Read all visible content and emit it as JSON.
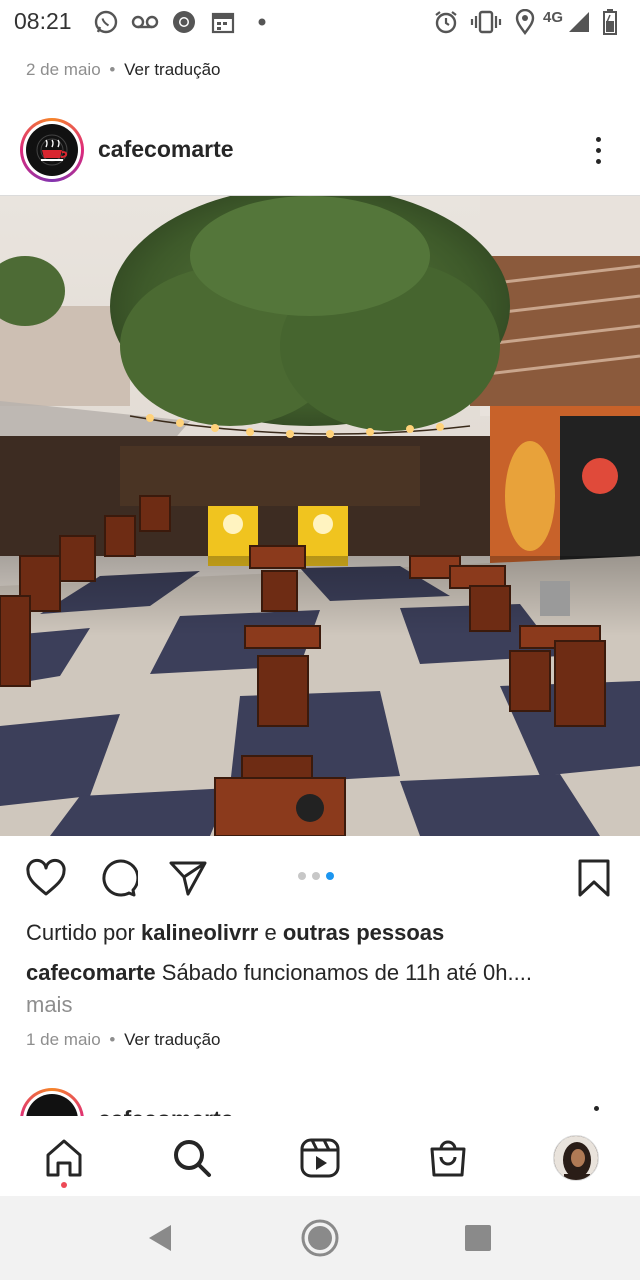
{
  "status_bar": {
    "time": "08:21",
    "network": "4G",
    "icons": [
      "whatsapp-icon",
      "voicemail-icon",
      "chrome-icon",
      "calendar-icon",
      "dot-icon",
      "alarm-icon",
      "vibrate-icon",
      "location-icon",
      "signal-icon",
      "battery-icon"
    ]
  },
  "previous_post": {
    "date": "2 de maio",
    "separator": "•",
    "translate": "Ver tradução"
  },
  "post": {
    "username": "cafecomarte",
    "more_icon": "more-vertical-icon",
    "image_alt": "cafecomarte outdoor patio",
    "carousel": {
      "count": 3,
      "active_index": 2
    },
    "actions": [
      "like-icon",
      "comment-icon",
      "share-icon",
      "bookmark-icon"
    ],
    "likes_prefix": "Curtido por",
    "likes_user": "kalineolivrr",
    "likes_and": "e",
    "likes_others": "outras pessoas",
    "caption_user": "cafecomarte",
    "caption_text": "Sábado funcionamos de 11h até 0h....",
    "caption_more": "mais",
    "date": "1 de maio",
    "separator": "•",
    "translate": "Ver tradução"
  },
  "next_post": {
    "username": "cafecomarte"
  },
  "bottom_nav": {
    "items": [
      "home-icon",
      "search-icon",
      "reels-icon",
      "shop-icon",
      "profile-avatar"
    ],
    "active": "home-icon"
  },
  "android_nav": {
    "items": [
      "back-icon",
      "home-circle-icon",
      "recents-icon"
    ]
  },
  "colors": {
    "text": "#262626",
    "muted": "#8e8e8e",
    "accent": "#1c96f0",
    "notification": "#ed4956"
  }
}
